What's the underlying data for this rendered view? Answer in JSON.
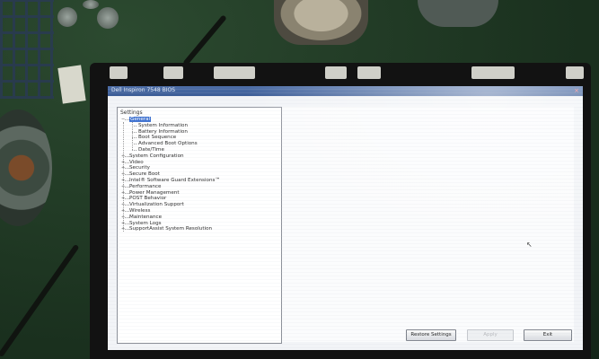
{
  "window": {
    "title": "Dell Inspiron 7548 BIOS",
    "close_glyph": "×"
  },
  "tree": {
    "header": "Settings",
    "items": [
      {
        "label": "General",
        "level": 0,
        "expanded": true,
        "selected": true
      },
      {
        "label": "System Information",
        "level": 1
      },
      {
        "label": "Battery Information",
        "level": 1
      },
      {
        "label": "Boot Sequence",
        "level": 1
      },
      {
        "label": "Advanced Boot Options",
        "level": 1
      },
      {
        "label": "Date/Time",
        "level": 1
      },
      {
        "label": "System Configuration",
        "level": 0
      },
      {
        "label": "Video",
        "level": 0
      },
      {
        "label": "Security",
        "level": 0
      },
      {
        "label": "Secure Boot",
        "level": 0
      },
      {
        "label": "Intel® Software Guard Extensions™",
        "level": 0
      },
      {
        "label": "Performance",
        "level": 0
      },
      {
        "label": "Power Management",
        "level": 0
      },
      {
        "label": "POST Behavior",
        "level": 0
      },
      {
        "label": "Virtualization Support",
        "level": 0
      },
      {
        "label": "Wireless",
        "level": 0
      },
      {
        "label": "Maintenance",
        "level": 0
      },
      {
        "label": "System Logs",
        "level": 0
      },
      {
        "label": "SupportAssist System Resolution",
        "level": 0
      }
    ],
    "expander_glyph": "+",
    "collapse_glyph": "−"
  },
  "buttons": {
    "restore": "Restore Settings",
    "apply": "Apply",
    "exit": "Exit"
  },
  "icons": {
    "mouse_cursor": "mouse-cursor-icon",
    "close": "close-icon"
  },
  "colors": {
    "titlebar": "#3b5c96",
    "selection": "#3a6fd0",
    "screen_bg": "#f2f4f7"
  }
}
